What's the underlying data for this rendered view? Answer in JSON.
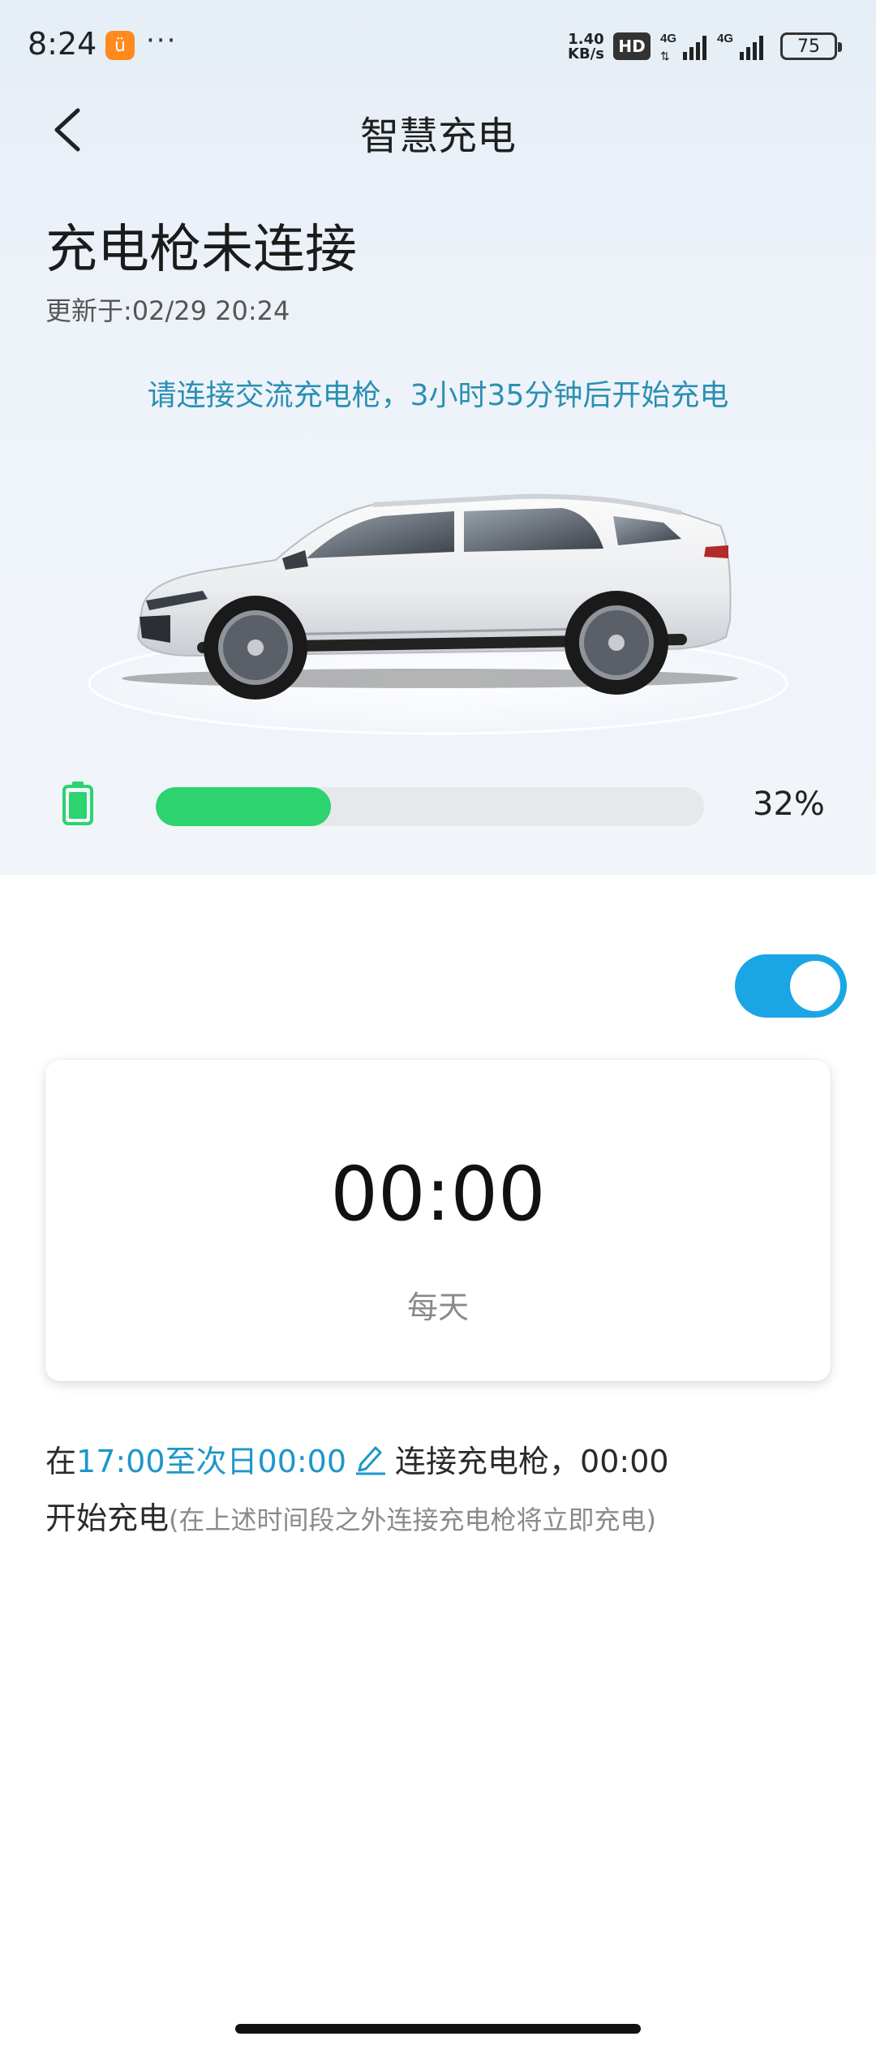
{
  "status_bar": {
    "time": "8:24",
    "app_icon": "taobao-icon",
    "more": "···",
    "net_speed_value": "1.40",
    "net_speed_unit": "KB/s",
    "hd_label": "HD",
    "signal_1": "4G",
    "signal_2": "4G",
    "battery": "75"
  },
  "header": {
    "title": "智慧充电",
    "back_icon": "chevron-left-icon"
  },
  "charging": {
    "status": "充电枪未连接",
    "updated": "更新于:02/29 20:24",
    "notice": "请连接交流充电枪，3小时35分钟后开始充电",
    "battery_percent_label": "32%",
    "battery_level": 0.32,
    "battery_color": "#2cd36e"
  },
  "schedule": {
    "toggle_on": true,
    "accent_color": "#1aa6e4",
    "time": "00:00",
    "repeat": "每天",
    "desc_prefix": "在",
    "desc_window": "17:00至次日00:00",
    "desc_middle": "连接充电枪，00:00",
    "desc_line2": "开始充电",
    "desc_note": "(在上述时间段之外连接充电枪将立即充电)"
  }
}
